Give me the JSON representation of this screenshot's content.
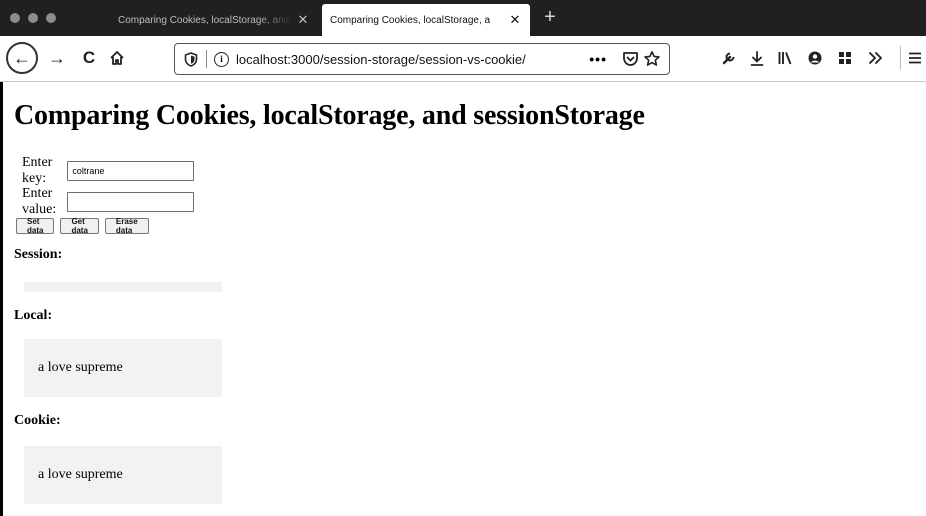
{
  "browser": {
    "tabs": [
      {
        "title": "Comparing Cookies, localStorage, and sessionStorage",
        "active": false
      },
      {
        "title": "Comparing Cookies, localStorage, a",
        "active": true
      }
    ],
    "tab_close_glyph": "✕",
    "new_tab_glyph": "+",
    "url": "localhost:3000/session-storage/session-vs-cookie/",
    "more_glyph": "•••",
    "toolbar_icons": [
      "wrench-icon",
      "download-icon",
      "library-icon",
      "account-icon",
      "extensions-icon",
      "overflow-icon",
      "menu-icon"
    ]
  },
  "page": {
    "title": "Comparing Cookies, localStorage, and sessionStorage",
    "key_label": "Enter key:",
    "key_value": "coltrane",
    "value_label": "Enter value:",
    "value_value": "",
    "buttons": {
      "set": "Set data",
      "get": "Get data",
      "erase": "Erase data"
    },
    "session": {
      "label": "Session:",
      "value": ""
    },
    "local": {
      "label": "Local:",
      "value": "a love supreme"
    },
    "cookie": {
      "label": "Cookie:",
      "value": "a love supreme"
    }
  }
}
